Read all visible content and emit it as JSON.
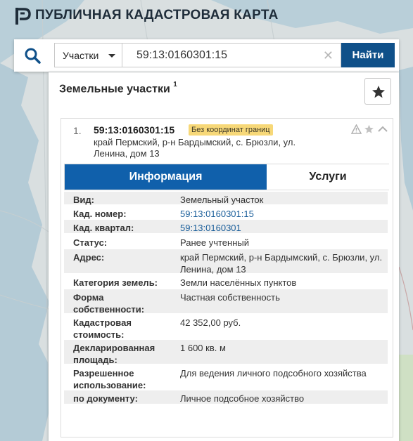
{
  "header": {
    "title": "ПУБЛИЧНАЯ КАДАСТРОВАЯ КАРТА"
  },
  "search": {
    "type_label": "Участки",
    "query": "59:13:0160301:15",
    "button_label": "Найти"
  },
  "results": {
    "title": "Земельные участки",
    "count": "1",
    "item": {
      "index": "1.",
      "cadastral_number": "59:13:0160301:15",
      "badge": "Без координат границ",
      "address": "край Пермский, р-н Бардымский, с. Брюзли, ул. Ленина, дом 13"
    }
  },
  "tabs": {
    "info": "Информация",
    "services": "Услуги"
  },
  "details": [
    {
      "label": "Вид:",
      "value": "Земельный участок"
    },
    {
      "label": "Кад. номер:",
      "value": "59:13:0160301:15",
      "link": true
    },
    {
      "label": "Кад. квартал:",
      "value": "59:13:0160301",
      "link": true
    },
    {
      "label": "Статус:",
      "value": "Ранее учтенный"
    },
    {
      "label": "Адрес:",
      "value": "край Пермский, р-н Бардымский, с. Брюзли, ул. Ленина, дом 13"
    },
    {
      "label": "Категория земель:",
      "value": "Земли населённых пунктов"
    },
    {
      "label": "Форма собственности:",
      "value": "Частная собственность"
    },
    {
      "label": "Кадастровая стоимость:",
      "value": "42 352,00 руб."
    },
    {
      "label": "Декларированная площадь:",
      "value": "1 600 кв. м"
    },
    {
      "label": "Разрешенное использование:",
      "value": "Для ведения личного подсобного хозяйства"
    },
    {
      "label": "по документу:",
      "value": "Личное подсобное хозяйство"
    }
  ],
  "colors": {
    "accent": "#1060ab",
    "button": "#0f5089",
    "badge": "#f7d878",
    "link": "#1a5e9a"
  },
  "icons": {
    "logo": "cadastre-logo-icon",
    "search": "search-icon",
    "clear": "clear-icon",
    "favorite": "star-icon",
    "warning": "warning-icon",
    "collapse": "chevron-up-icon"
  }
}
